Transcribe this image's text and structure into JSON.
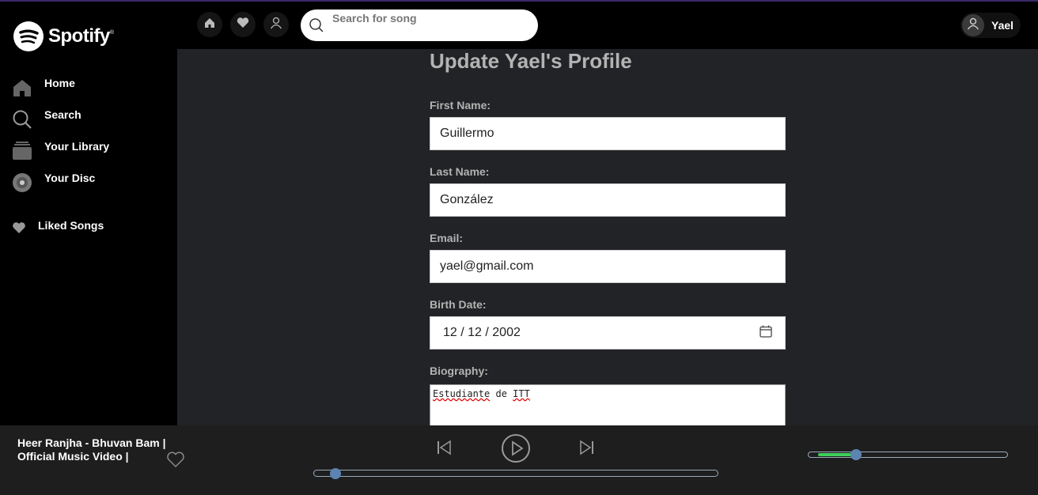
{
  "app": {
    "brand": "Spotify",
    "accent": "#3ecf5a"
  },
  "sidebar": {
    "items": [
      {
        "label": "Home",
        "icon": "home-icon"
      },
      {
        "label": "Search",
        "icon": "search-icon"
      },
      {
        "label": "Your Library",
        "icon": "library-icon"
      },
      {
        "label": "Your Disc",
        "icon": "disc-icon"
      },
      {
        "label": "Liked Songs",
        "icon": "heart-icon"
      }
    ]
  },
  "topbar": {
    "search_placeholder": "Search for song",
    "user_name": "Yael"
  },
  "profile_form": {
    "title": "Update Yael's Profile",
    "first_name_label": "First Name:",
    "first_name_value": "Guillermo",
    "last_name_label": "Last Name:",
    "last_name_value": "González",
    "email_label": "Email:",
    "email_value": "yael@gmail.com",
    "birth_date_label": "Birth Date:",
    "birth_date_value": "12 / 12 / 2002",
    "biography_label": "Biography:",
    "biography_word1": "Estudiante",
    "biography_word2": "de",
    "biography_word3": "ITT"
  },
  "player": {
    "song_title": "Heer Ranjha - Bhuvan Bam | Official Music Video |",
    "progress": 0.04,
    "volume": 0.24
  }
}
